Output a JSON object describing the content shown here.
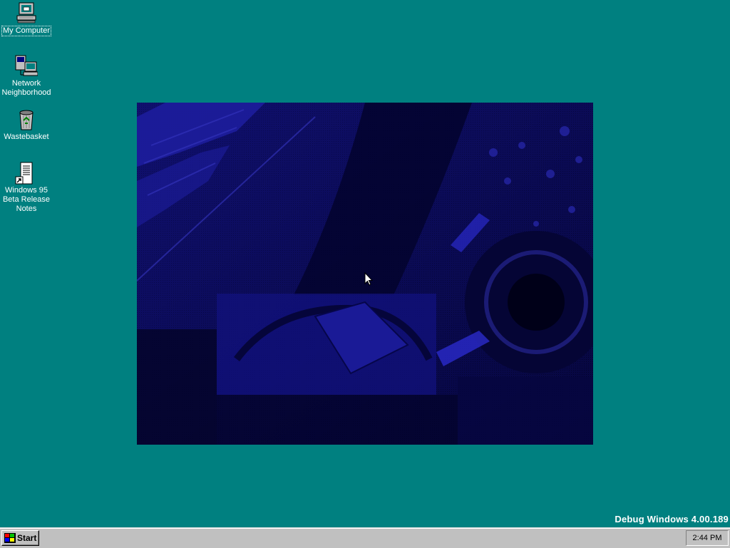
{
  "desktop": {
    "background_color": "#008080",
    "icons": [
      {
        "label": "My Computer",
        "icon": "my-computer-icon",
        "selected": true
      },
      {
        "label": "Network Neighborhood",
        "icon": "network-neighborhood-icon"
      },
      {
        "label": "Wastebasket",
        "icon": "wastebasket-icon"
      },
      {
        "label": "Windows 95 Beta Release Notes",
        "icon": "release-notes-shortcut-icon"
      }
    ],
    "version_text": "Debug Windows 4.00.189"
  },
  "taskbar": {
    "start_label": "Start",
    "clock": "2:44 PM"
  }
}
